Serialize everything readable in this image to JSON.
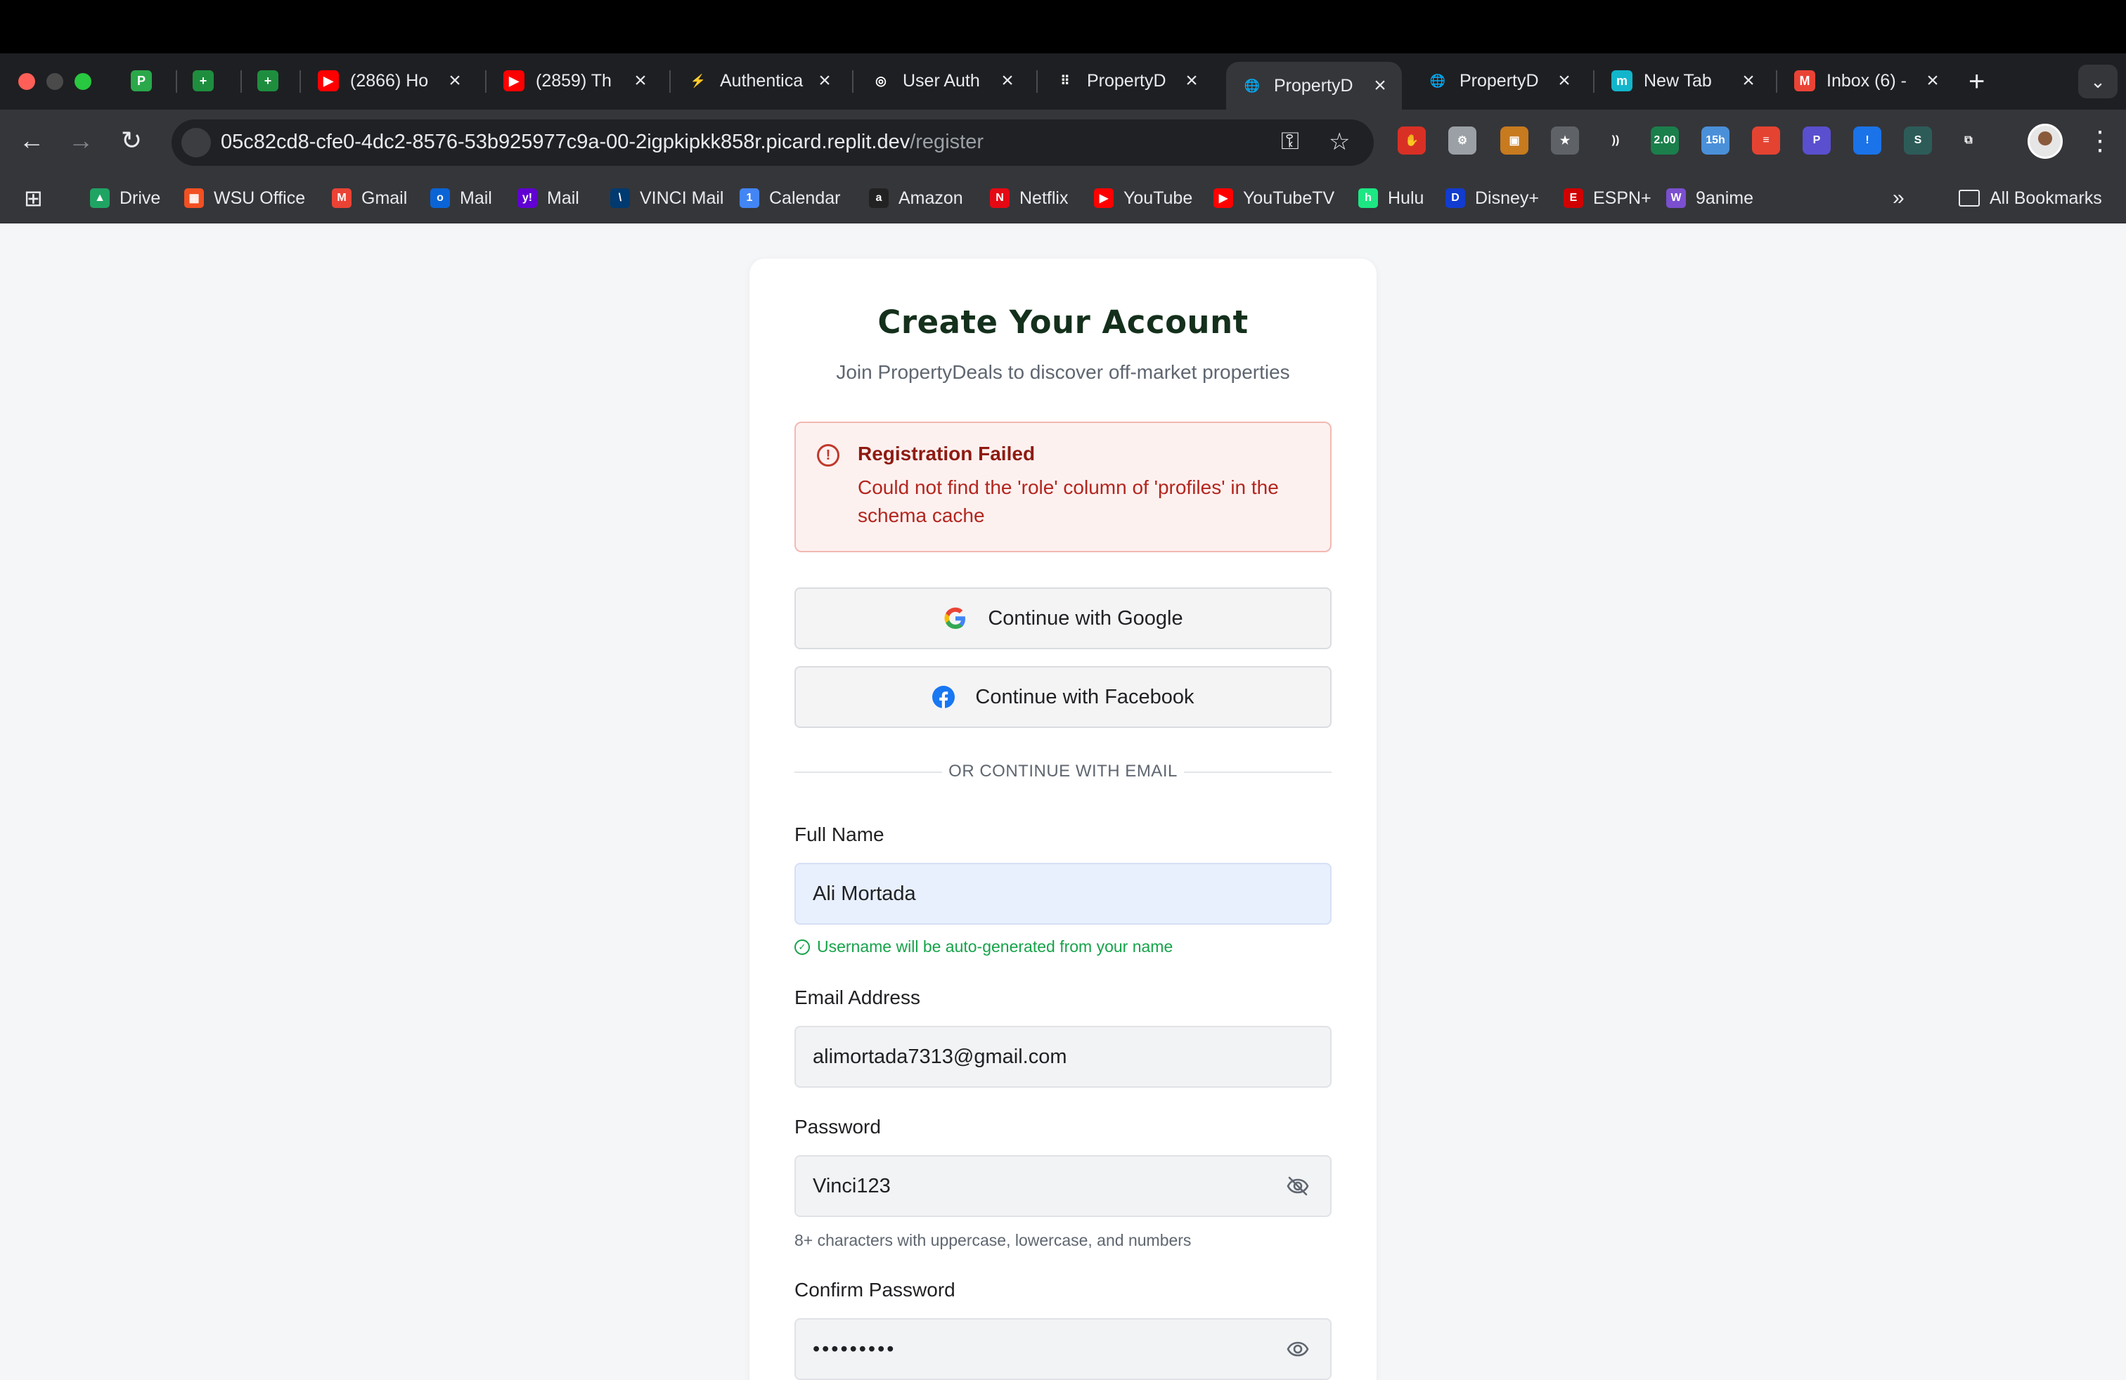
{
  "browser": {
    "tabs": [
      {
        "title": "",
        "favicon": "P",
        "color": "#2aa84a"
      },
      {
        "title": "",
        "favicon": "+",
        "color": "#1e8e3e"
      },
      {
        "title": "",
        "favicon": "+",
        "color": "#1e8e3e"
      },
      {
        "title": "(2866) Ho",
        "favicon": "▶",
        "color": "#ff0000"
      },
      {
        "title": "(2859) Th",
        "favicon": "▶",
        "color": "#ff0000"
      },
      {
        "title": "Authentica",
        "favicon": "⚡",
        "color": "#1e1f22"
      },
      {
        "title": "User Auth",
        "favicon": "◎",
        "color": "#1e1f22"
      },
      {
        "title": "PropertyD",
        "favicon": "⠿",
        "color": "#1e1f22"
      },
      {
        "title": "PropertyD",
        "favicon": "🌐",
        "color": "#35363a"
      },
      {
        "title": "PropertyD",
        "favicon": "🌐",
        "color": "#1e1f22"
      },
      {
        "title": "New Tab",
        "favicon": "m",
        "color": "#12b5cb"
      },
      {
        "title": "Inbox (6) -",
        "favicon": "M",
        "color": "#ea4335"
      }
    ],
    "url_host": "05c82cd8-cfe0-4dc2-8576-53b925977c9a-00-2igpkipkk858r.picard.replit.dev",
    "url_path": "/register",
    "extensions": [
      {
        "label": "✋",
        "color": "#d93025"
      },
      {
        "label": "⚙",
        "color": "#9aa0a6"
      },
      {
        "label": "▣",
        "color": "#c87a1e"
      },
      {
        "label": "★",
        "color": "#5f6368"
      },
      {
        "label": "))",
        "color": "#35363a"
      },
      {
        "label": "2.00",
        "color": "#1a7f4b"
      },
      {
        "label": "15h",
        "color": "#4a90d9"
      },
      {
        "label": "≡",
        "color": "#e44332"
      },
      {
        "label": "P",
        "color": "#5a4fcf"
      },
      {
        "label": "!",
        "color": "#1a73e8"
      },
      {
        "label": "S",
        "color": "#2d5c58"
      },
      {
        "label": "⧉",
        "color": "#35363a"
      }
    ],
    "bookmarks": [
      {
        "label": "Drive",
        "icon": "▲",
        "color": "#1fa463"
      },
      {
        "label": "WSU Office",
        "icon": "▦",
        "color": "#f25022"
      },
      {
        "label": "Gmail",
        "icon": "M",
        "color": "#ea4335"
      },
      {
        "label": "Mail",
        "icon": "o",
        "color": "#0a64d6"
      },
      {
        "label": "Mail",
        "icon": "y!",
        "color": "#6001d2"
      },
      {
        "label": "VINCI Mail",
        "icon": "\\",
        "color": "#003a70"
      },
      {
        "label": "Calendar",
        "icon": "1",
        "color": "#4285f4"
      },
      {
        "label": "Amazon",
        "icon": "a",
        "color": "#222222"
      },
      {
        "label": "Netflix",
        "icon": "N",
        "color": "#e50914"
      },
      {
        "label": "YouTube",
        "icon": "▶",
        "color": "#ff0000"
      },
      {
        "label": "YouTubeTV",
        "icon": "▶",
        "color": "#ff0000"
      },
      {
        "label": "Hulu",
        "icon": "h",
        "color": "#1ce783"
      },
      {
        "label": "Disney+",
        "icon": "D",
        "color": "#113ccf"
      },
      {
        "label": "ESPN+",
        "icon": "E",
        "color": "#d00000"
      },
      {
        "label": "9anime",
        "icon": "W",
        "color": "#7b4fcf"
      }
    ],
    "all_bookmarks": "All Bookmarks"
  },
  "page": {
    "title": "Create Your Account",
    "subtitle": "Join PropertyDeals to discover off-market properties",
    "alert": {
      "title": "Registration Failed",
      "message": "Could not find the 'role' column of 'profiles' in the schema cache"
    },
    "google_button": "Continue with Google",
    "facebook_button": "Continue with Facebook",
    "divider": "OR CONTINUE WITH EMAIL",
    "full_name": {
      "label": "Full Name",
      "value": "Ali Mortada",
      "hint": "Username will be auto-generated from your name"
    },
    "email": {
      "label": "Email Address",
      "value": "alimortada7313@gmail.com"
    },
    "password": {
      "label": "Password",
      "value": "Vinci123",
      "hint": "8+ characters with uppercase, lowercase, and numbers"
    },
    "confirm_password": {
      "label": "Confirm Password",
      "value": "•••••••••"
    }
  },
  "colors": {
    "title": "#14301c",
    "alert_text": "#b3261e",
    "success": "#16a34a"
  }
}
